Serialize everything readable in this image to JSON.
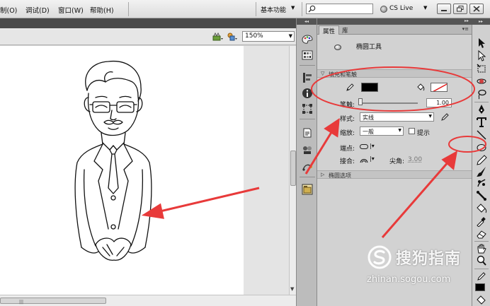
{
  "menu": {
    "items": [
      "制(O)",
      "调试(D)",
      "窗口(W)",
      "帮助(H)"
    ],
    "workspace": "基本功能",
    "search_placeholder": "",
    "cs_live": "CS Live"
  },
  "stage": {
    "zoom": "150%"
  },
  "properties": {
    "tabs": [
      "属性",
      "库"
    ],
    "tool_name": "椭圆工具",
    "section_fill_stroke": "填充和笔触",
    "stroke_color": "#000000",
    "stroke_label": "笔触:",
    "stroke_width": "1.00",
    "style_label": "样式:",
    "style_value": "实线",
    "scale_label": "缩放:",
    "scale_value": "一般",
    "hint_label": "提示",
    "cap_label": "端点:",
    "join_label": "接合:",
    "miter_label": "尖角:",
    "miter_value": "3.00",
    "section_ellipse": "椭圆选项"
  },
  "watermark": {
    "title": "搜狗指南",
    "url": "zhinan.sogou.com"
  },
  "annotation_color": "#e83a3a"
}
